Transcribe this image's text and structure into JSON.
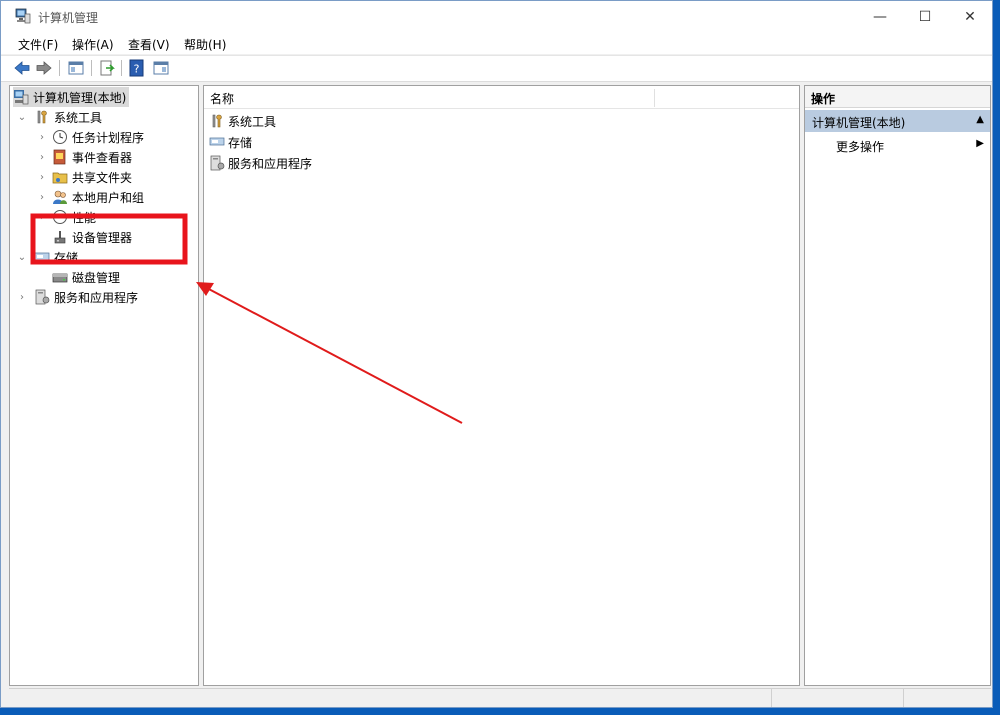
{
  "window": {
    "title": "计算机管理",
    "controls": {
      "minimize": "—",
      "maximize": "☐",
      "close": "✕"
    }
  },
  "menu": [
    "文件(F)",
    "操作(A)",
    "查看(V)",
    "帮助(H)"
  ],
  "toolbar": {
    "buttons": [
      "back-icon",
      "forward-icon",
      "show-hide-tree-icon",
      "export-list-icon",
      "help-icon",
      "properties-icon"
    ]
  },
  "tree": {
    "root": "计算机管理(本地)",
    "system_tools": {
      "label": "系统工具",
      "children": [
        "任务计划程序",
        "事件查看器",
        "共享文件夹",
        "本地用户和组",
        "性能",
        "设备管理器"
      ]
    },
    "storage": {
      "label": "存储",
      "children": [
        "磁盘管理"
      ]
    },
    "services": "服务和应用程序"
  },
  "list": {
    "column_header": "名称",
    "items": [
      "系统工具",
      "存储",
      "服务和应用程序"
    ]
  },
  "actions": {
    "header": "操作",
    "section": "计算机管理(本地)",
    "more": "更多操作"
  },
  "colors": {
    "highlight_box": "#e8141c",
    "arrow": "#e01b1b",
    "action_section_bg": "#b9cbe0",
    "desktop": "#0a5cb8"
  }
}
